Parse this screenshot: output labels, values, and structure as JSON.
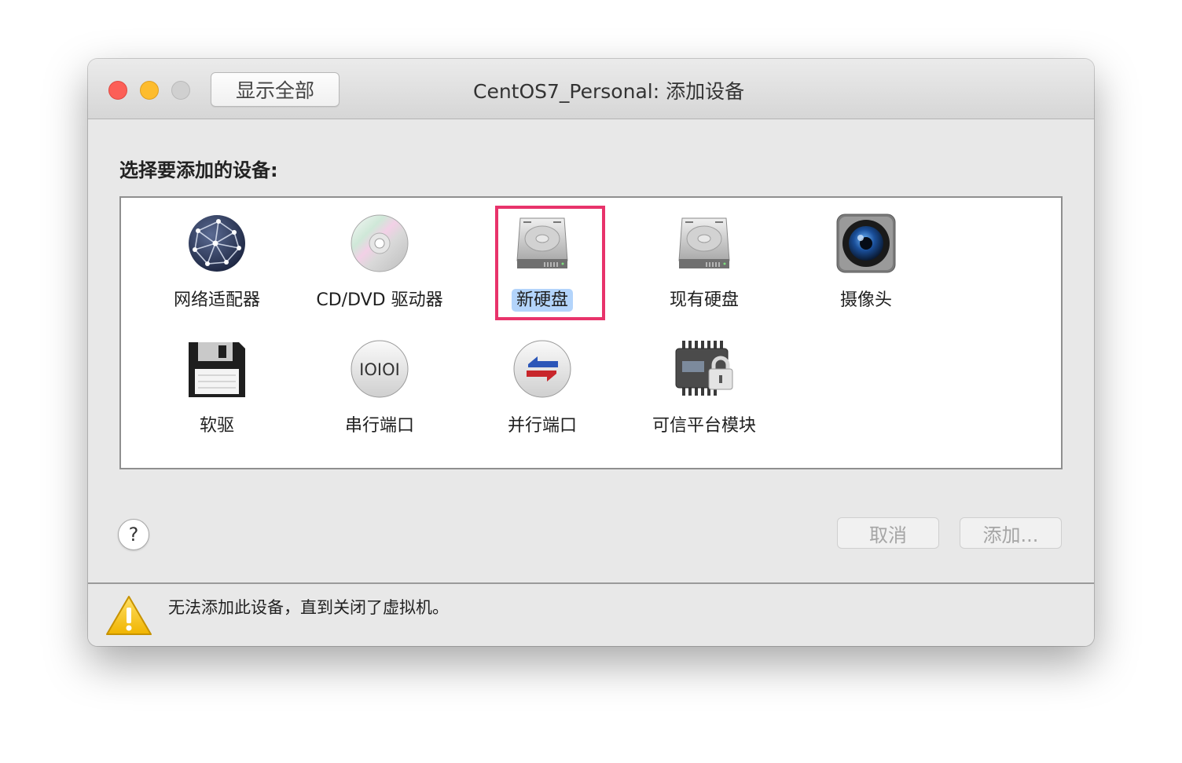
{
  "window": {
    "show_all_label": "显示全部",
    "title": "CentOS7_Personal: 添加设备"
  },
  "content": {
    "prompt": "选择要添加的设备:",
    "devices": [
      {
        "label": "网络适配器",
        "icon": "network-globe-icon",
        "selected": false
      },
      {
        "label": "CD/DVD 驱动器",
        "icon": "cd-dvd-disc-icon",
        "selected": false
      },
      {
        "label": "新硬盘",
        "icon": "hard-disk-icon",
        "selected": true
      },
      {
        "label": "现有硬盘",
        "icon": "hard-disk-icon",
        "selected": false
      },
      {
        "label": "摄像头",
        "icon": "camera-icon",
        "selected": false
      },
      {
        "label": "软驱",
        "icon": "floppy-disk-icon",
        "selected": false
      },
      {
        "label": "串行端口",
        "icon": "serial-port-icon",
        "selected": false,
        "icon_text": "IOIOI"
      },
      {
        "label": "并行端口",
        "icon": "parallel-port-icon",
        "selected": false
      },
      {
        "label": "可信平台模块",
        "icon": "tpm-chip-lock-icon",
        "selected": false
      }
    ]
  },
  "buttons": {
    "help": "?",
    "cancel": "取消",
    "add": "添加..."
  },
  "footer": {
    "warning_icon": "warning-triangle-icon",
    "warning_text": "无法添加此设备，直到关闭了虚拟机。"
  },
  "colors": {
    "selection_frame": "#e8336b",
    "selection_label_bg": "#b3d4fb",
    "close": "#fc5f57",
    "minimize": "#fdbc2e"
  }
}
